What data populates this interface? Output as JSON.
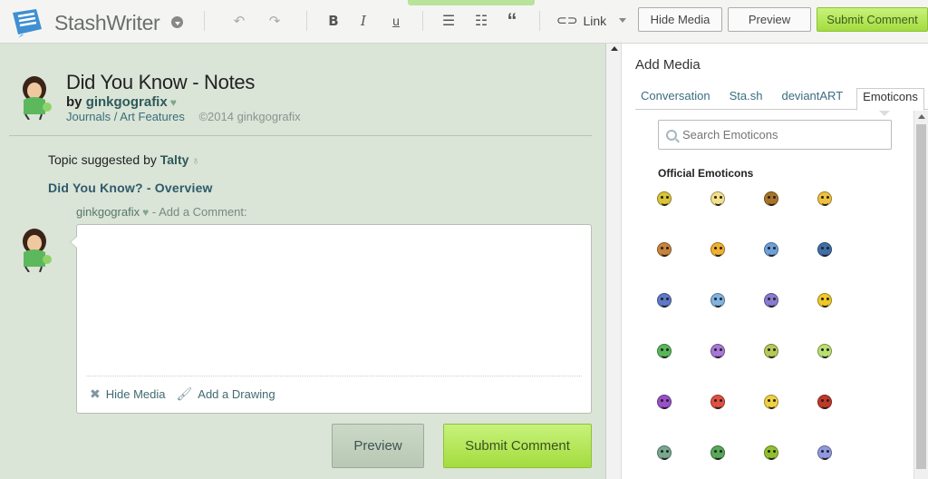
{
  "app": {
    "name": "StashWriter"
  },
  "toolbar": {
    "link_label": "Link",
    "hide_media": "Hide Media",
    "preview": "Preview",
    "submit": "Submit Comment"
  },
  "journal": {
    "title": "Did You Know - Notes",
    "by_prefix": "by",
    "author": "ginkgografix",
    "crumb_1": "Journals",
    "crumb_sep": "/",
    "crumb_2": "Art Features",
    "copyright": "©2014 ginkgografix",
    "topic_prefix": "Topic suggested by",
    "topic_user": "Talty",
    "overview_link": "Did You Know? - Overview"
  },
  "comment": {
    "user": "ginkgografix",
    "add_label": "- Add a Comment:",
    "hide_media": "Hide Media",
    "add_drawing": "Add a Drawing",
    "preview": "Preview",
    "submit": "Submit Comment"
  },
  "panel": {
    "title": "Add Media",
    "tabs": [
      "Conversation",
      "Sta.sh",
      "deviantART",
      "Emoticons"
    ],
    "search_placeholder": "Search Emoticons",
    "section": "Official Emoticons",
    "emoticons": [
      {
        "name": "emoticon-smile",
        "color": "#d9c43a"
      },
      {
        "name": "emoticon-grin",
        "color": "#f2e08a"
      },
      {
        "name": "emoticon-cool",
        "color": "#a9742a"
      },
      {
        "name": "emoticon-tongue",
        "color": "#f0c040"
      },
      {
        "name": "emoticon-tan",
        "color": "#c8843c"
      },
      {
        "name": "emoticon-neutral",
        "color": "#f0b030"
      },
      {
        "name": "emoticon-sad-blue",
        "color": "#6fa0d8"
      },
      {
        "name": "emoticon-angry-blue",
        "color": "#3f6ea8"
      },
      {
        "name": "emoticon-dizzy",
        "color": "#5f78c8"
      },
      {
        "name": "emoticon-cold",
        "color": "#7fb4e0"
      },
      {
        "name": "emoticon-purple-wave",
        "color": "#8a7ad0"
      },
      {
        "name": "emoticon-wink-gold",
        "color": "#f0c828"
      },
      {
        "name": "emoticon-green-laugh",
        "color": "#58b858"
      },
      {
        "name": "emoticon-purple",
        "color": "#a878d8"
      },
      {
        "name": "emoticon-olive",
        "color": "#b8c858"
      },
      {
        "name": "emoticon-lime",
        "color": "#b8e070"
      },
      {
        "name": "emoticon-violet",
        "color": "#9850c8"
      },
      {
        "name": "emoticon-red",
        "color": "#e05040"
      },
      {
        "name": "emoticon-worried",
        "color": "#f0d040"
      },
      {
        "name": "emoticon-mad",
        "color": "#c03828"
      },
      {
        "name": "emoticon-pair",
        "color": "#78a890"
      },
      {
        "name": "emoticon-green",
        "color": "#58a858"
      },
      {
        "name": "emoticon-blob",
        "color": "#90c030"
      },
      {
        "name": "emoticon-ghost",
        "color": "#9098e0"
      }
    ]
  }
}
